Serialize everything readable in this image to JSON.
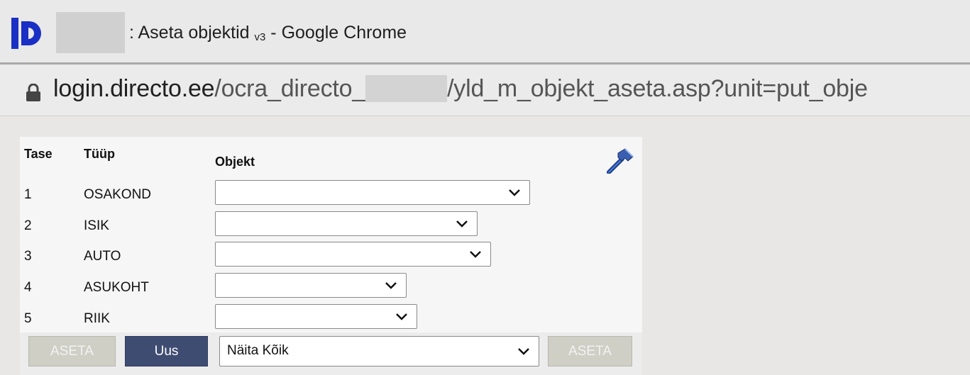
{
  "window": {
    "title": ": Aseta objektid",
    "title_version": "v3",
    "title_suffix": " - Google Chrome"
  },
  "address": {
    "host": "login.directo.ee",
    "path_start": "/ocra_directo_",
    "path_end": "/yld_m_objekt_aseta.asp?unit=put_obje"
  },
  "table": {
    "headers": {
      "level": "Tase",
      "type": "Tüüp",
      "object": "Objekt"
    },
    "rows": [
      {
        "level": "1",
        "type": "OSAKOND",
        "value": ""
      },
      {
        "level": "2",
        "type": "ISIK",
        "value": ""
      },
      {
        "level": "3",
        "type": "AUTO",
        "value": ""
      },
      {
        "level": "4",
        "type": "ASUKOHT",
        "value": ""
      },
      {
        "level": "5",
        "type": "RIIK",
        "value": ""
      }
    ]
  },
  "actions": {
    "set_label": "ASETA",
    "new_label": "Uus",
    "filter_value": "Näita Kõik",
    "set_label_2": "ASETA"
  },
  "colors": {
    "brand": "#1a2fc4",
    "primary_button": "#3f4c72",
    "disabled_button": "#cfcfc6"
  },
  "icons": {
    "logo": "directo-logo-icon",
    "lock": "lock-icon",
    "settings": "hammer-icon",
    "dropdown": "chevron-down-icon"
  }
}
